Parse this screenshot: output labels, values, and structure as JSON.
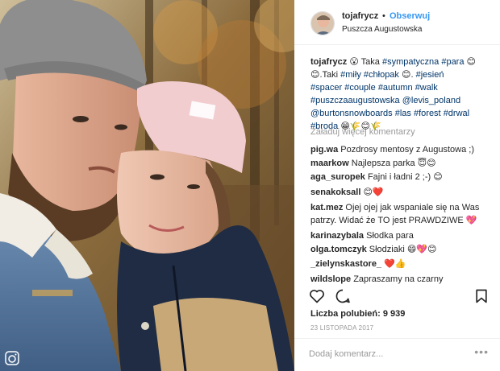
{
  "post": {
    "username": "tojafrycz",
    "separator": "•",
    "follow_label": "Obserwuj",
    "location": "Puszcza Augustowska",
    "photo_alt": "selfie",
    "caption": {
      "username": "tojafrycz",
      "line1": "😮 Taka #sympatyczna #para 😊",
      "line2": "😊.Taki #miły #chłopak 😊. #jesień",
      "line3": "#spacer #couple #autumn #walk",
      "line4": "#puszczaaugustowska @levis_poland",
      "line5": "@burtonsnowboards #las #forest #drwal",
      "line6": "#broda 😁🌾😊🌾"
    },
    "load_more": "Załaduj więcej komentarzy",
    "comments": [
      {
        "user": "pig.wa",
        "text": "Pozdrosy mentosy z Augustowa ;)"
      },
      {
        "user": "maarkow",
        "text": "Najlepsza parka 😇😊"
      },
      {
        "user": "aga_suropek",
        "text": "Fajni i ładni 2 ;-) 😊"
      },
      {
        "user": "senakoksall",
        "text": "😊❤️"
      },
      {
        "user": "kat.mez",
        "text": "Ojej ojej jak wspaniale się na Was",
        "text2": "patrzy. Widać że TO jest PRAWDZIWE 💖"
      },
      {
        "user": "karinazybala",
        "text": "Słodka para"
      },
      {
        "user": "olga.tomczyk",
        "text": "Słodziaki 😄💖😊"
      },
      {
        "user": "_zielynskastore_",
        "text": "❤️👍"
      },
      {
        "user": "wildslope",
        "text": "Zapraszamy na czarny"
      }
    ],
    "likes": "Liczba polubień: 9 939",
    "date": "23 listopada 2017",
    "add_comment_placeholder": "Dodaj komentarz...",
    "more_options": "•••",
    "icons": {
      "like": "heart-icon",
      "comment": "comment-icon",
      "save": "bookmark-icon",
      "igtv": "igtv-icon"
    },
    "colors": {
      "link": "#3897f0",
      "hashtag": "#003569",
      "muted": "#999999",
      "text": "#262626"
    }
  }
}
